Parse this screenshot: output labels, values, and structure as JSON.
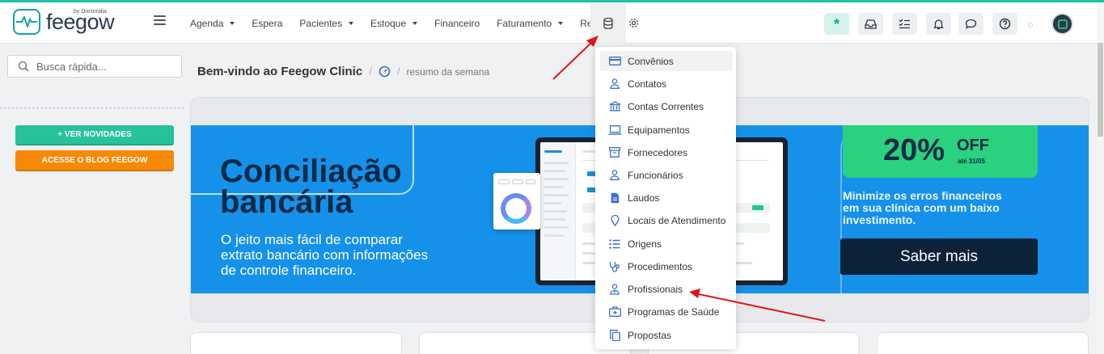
{
  "app": {
    "logo_text": "feegow",
    "logo_by": "by Doctoralia"
  },
  "nav": {
    "items": [
      {
        "label": "Agenda",
        "dropdown": true
      },
      {
        "label": "Espera",
        "dropdown": false
      },
      {
        "label": "Pacientes",
        "dropdown": true
      },
      {
        "label": "Estoque",
        "dropdown": true
      },
      {
        "label": "Financeiro",
        "dropdown": false
      },
      {
        "label": "Faturamento",
        "dropdown": true
      },
      {
        "label": "Relatórios",
        "dropdown": false
      }
    ],
    "icon_database": "database-icon",
    "icon_settings": "gear-icon"
  },
  "header_icons": [
    "asterisk-icon",
    "inbox-icon",
    "checklist-icon",
    "bell-icon",
    "chat-icon",
    "help-icon"
  ],
  "search": {
    "placeholder": "Busca rápida..."
  },
  "sidebar": {
    "news_button": "+ VER NOVIDADES",
    "blog_button": "ACESSE O BLOG FEEGOW"
  },
  "breadcrumb": {
    "title": "Bem-vindo ao Feegow Clinic",
    "sub": "resumo da semana"
  },
  "banner": {
    "title_line1": "Conciliação",
    "title_line2": "bancária",
    "desc_line1": "O jeito mais fácil de comparar",
    "desc_line2": "extrato bancário com informações",
    "desc_line3": "de controle financeiro.",
    "promo_pct": "20%",
    "promo_off": "OFF",
    "promo_date": "até 31/05",
    "promo_line1": "Minimize os erros financeiros",
    "promo_line2": "em sua clínica com um baixo",
    "promo_line3": "investimento.",
    "button": "Saber mais"
  },
  "dropdown": {
    "items": [
      {
        "label": "Convênios",
        "icon": "card-icon",
        "highlighted": true
      },
      {
        "label": "Contatos",
        "icon": "user-icon"
      },
      {
        "label": "Contas Correntes",
        "icon": "bank-icon"
      },
      {
        "label": "Equipamentos",
        "icon": "laptop-icon"
      },
      {
        "label": "Fornecedores",
        "icon": "archive-icon"
      },
      {
        "label": "Funcionários",
        "icon": "user-icon"
      },
      {
        "label": "Laudos",
        "icon": "document-icon"
      },
      {
        "label": "Locais de Atendimento",
        "icon": "map-pin-icon"
      },
      {
        "label": "Origens",
        "icon": "list-icon"
      },
      {
        "label": "Procedimentos",
        "icon": "stethoscope-icon"
      },
      {
        "label": "Profissionais",
        "icon": "doctor-icon"
      },
      {
        "label": "Programas de Saúde",
        "icon": "health-kit-icon"
      },
      {
        "label": "Propostas",
        "icon": "copy-icon"
      }
    ]
  },
  "colors": {
    "brand": "#15a3a0",
    "banner_bg": "#1591ea",
    "promo_green": "#2ad17e",
    "news_button": "#26c29c",
    "blog_button": "#f68a07",
    "icon_blue": "#3d6fc4",
    "annotation_arrow": "#e0141b"
  }
}
